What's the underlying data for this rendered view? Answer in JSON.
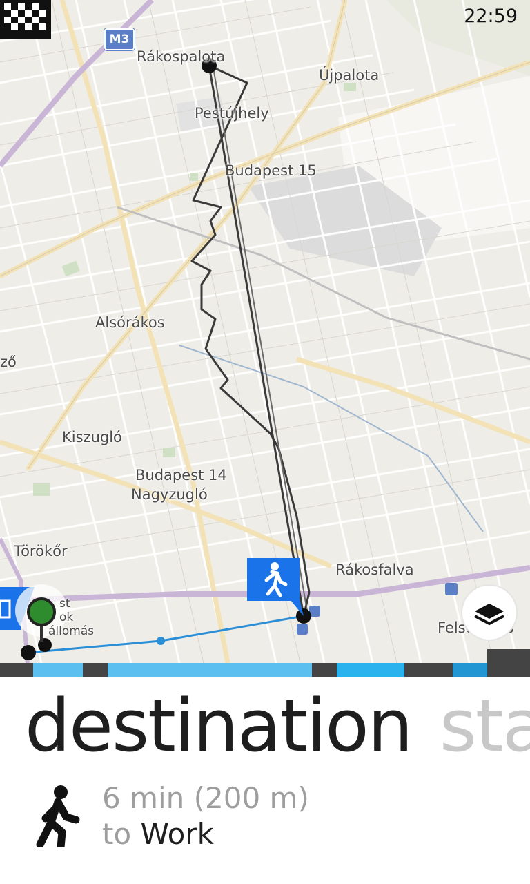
{
  "status_bar": {
    "time": "22:59"
  },
  "map": {
    "highway_shield": "M3",
    "places": [
      {
        "name": "Rákospalota",
        "key": "rakospalota"
      },
      {
        "name": "Újpalota",
        "key": "ujpalota"
      },
      {
        "name": "Pestújhely",
        "key": "pestujhely"
      },
      {
        "name": "Budapest 15",
        "key": "budapest15"
      },
      {
        "name": "Alsórákos",
        "key": "alsorakos"
      },
      {
        "name": "ző",
        "key": "zo"
      },
      {
        "name": "Kiszugló",
        "key": "kiszuglo"
      },
      {
        "name": "Budapest 14",
        "key": "budapest14"
      },
      {
        "name": "Nagyzugló",
        "key": "nagyzuglo"
      },
      {
        "name": "Törökőr",
        "key": "torokor"
      },
      {
        "name": "Rákosfalva",
        "key": "rakosfalva"
      },
      {
        "name": "Felsőrákos",
        "key": "felsorakos"
      },
      {
        "name": "st",
        "key": "st"
      },
      {
        "name": "ok",
        "key": "ok"
      },
      {
        "name": "Pályaudvar állomás",
        "key": "allomas",
        "display": "állomás"
      }
    ],
    "route_color": "#333333",
    "transit_color": "#2b8fd8",
    "start_marker_color": "#2e8b2e",
    "walk_marker_color": "#1a73e8"
  },
  "progress": {
    "segments": [
      {
        "kind": "dark"
      },
      {
        "kind": "light"
      },
      {
        "kind": "dark"
      },
      {
        "kind": "light"
      },
      {
        "kind": "dark"
      },
      {
        "kind": "light"
      },
      {
        "kind": "dark"
      },
      {
        "kind": "light"
      },
      {
        "kind": "dark"
      }
    ]
  },
  "panel": {
    "pivot_active": "destination",
    "pivot_next": "sta",
    "duration": "6 min (200 m)",
    "to_label": "to",
    "destination": "Work",
    "mode_icon": "walking-icon"
  }
}
